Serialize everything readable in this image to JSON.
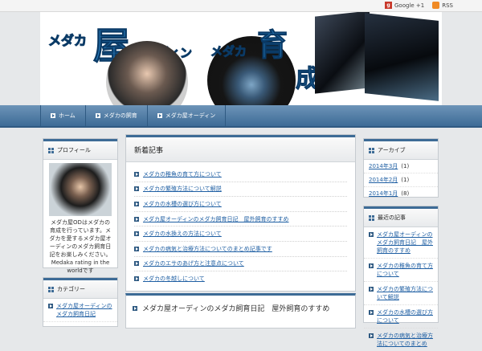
{
  "topbar": {
    "google_label": "Google +1",
    "rss_label": "RSS"
  },
  "banner": {
    "text_left_small": "メダカ",
    "text_left_big": "屋",
    "text_left_tail": "オーディン",
    "text_right_small": "メダカ",
    "text_right_big": "育",
    "text_right_tail": "成"
  },
  "nav": {
    "items": [
      "ホーム",
      "メダカの飼育",
      "メダカ屋オーディン"
    ]
  },
  "left": {
    "profile_title": "プロフィール",
    "profile_text": "メダカ屋ODはメダカの育成を行っています。メダカを愛するメダカ屋オーディンのメダカ飼育日記をお楽しみください。",
    "profile_text2": "Medaka rating in the world",
    "profile_text3": "です",
    "cat_title": "カテゴリー",
    "cat_links": [
      "メダカ屋オーディンのメダカ飼育日記"
    ]
  },
  "main": {
    "title": "新着記事",
    "items": [
      "メダカの稚魚の育て方について",
      "メダカの繁殖方法について解説",
      "メダカの水槽の選び方について",
      "メダカ屋オーディンのメダカ飼育日記　屋外飼育のすすめ",
      "メダカの水換えの方法について",
      "メダカの病気と治療方法についてのまとめ記事です",
      "メダカのエサのあげ方と注意点について",
      "メダカの冬越しについて"
    ],
    "post_title": "メダカ屋オーディンのメダカ飼育日記　屋外飼育のすすめ"
  },
  "right": {
    "archive_title": "アーカイブ",
    "archives": [
      {
        "label": "2014年3月",
        "count": "(1)"
      },
      {
        "label": "2014年2月",
        "count": "(1)"
      },
      {
        "label": "2014年1月",
        "count": "(8)"
      }
    ],
    "recent_title": "最近の記事",
    "recent": [
      "メダカ屋オーディンのメダカ飼育日記　屋外飼育のすすめ",
      "メダカの稚魚の育て方について",
      "メダカの繁殖方法について解説",
      "メダカの水槽の選び方について",
      "メダカの病気と治療方法についてのまとめ"
    ]
  },
  "colors": {
    "accent": "#3d6b96",
    "link": "#1f5fa3",
    "logo_blue": "#2a7fbf"
  }
}
